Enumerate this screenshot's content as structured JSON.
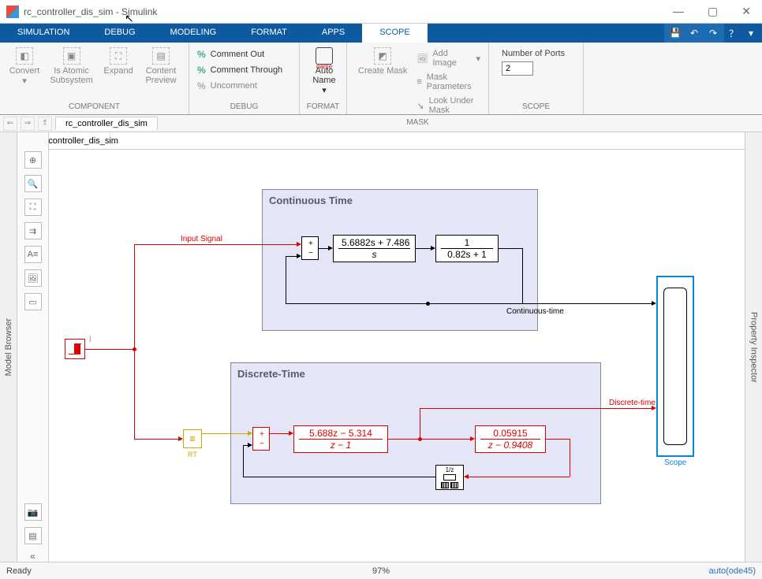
{
  "window": {
    "title": "rc_controller_dis_sim - Simulink",
    "app_name": "Simulink"
  },
  "ribbon": {
    "tabs": [
      "SIMULATION",
      "DEBUG",
      "MODELING",
      "FORMAT",
      "APPS",
      "SCOPE"
    ],
    "active_tab": "SCOPE"
  },
  "toolstrip": {
    "component": {
      "label": "COMPONENT",
      "convert": "Convert",
      "atomic": "Is Atomic Subsystem",
      "expand": "Expand",
      "preview": "Content Preview"
    },
    "debug": {
      "label": "DEBUG",
      "comment_out": "Comment Out",
      "comment_through": "Comment Through",
      "uncomment": "Uncomment"
    },
    "format": {
      "label": "FORMAT",
      "auto_name": "Auto Name",
      "name_badge": "name"
    },
    "mask": {
      "label": "MASK",
      "create": "Create Mask",
      "add_image": "Add Image",
      "mask_params": "Mask Parameters",
      "look_under": "Look Under Mask"
    },
    "scope": {
      "label": "SCOPE",
      "ports_label": "Number of Ports",
      "ports_value": "2"
    }
  },
  "document": {
    "tab": "rc_controller_dis_sim",
    "breadcrumb": "rc_controller_dis_sim"
  },
  "panels": {
    "left": "Model Browser",
    "right": "Property Inspector"
  },
  "canvas": {
    "continuous": {
      "title": "Continuous Time",
      "tf1_num": "5.6882s + 7.486",
      "tf1_den": "s",
      "tf2_num": "1",
      "tf2_den": "0.82s + 1",
      "sig_label": "Continuous-time"
    },
    "discrete": {
      "title": "Discrete-Time",
      "tf1_num": "5.688z − 5.314",
      "tf1_den": "z − 1",
      "tf2_num": "0.05915",
      "tf2_den": "z − 0.9408",
      "mem_label": "1/z",
      "sig_label": "Discrete-time"
    },
    "input_label": "Input Signal",
    "rt_label": "RT",
    "scope_label": "Scope"
  },
  "status": {
    "ready": "Ready",
    "zoom": "97%",
    "solver": "auto(ode45)"
  }
}
